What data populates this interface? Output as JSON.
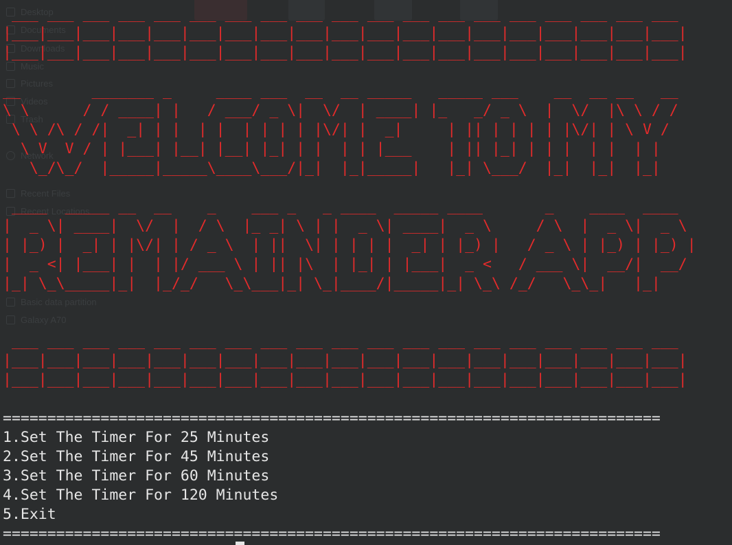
{
  "colors": {
    "background": "#2b2d2e",
    "banner": "#e32b2b",
    "menu_text": "#e6e6e6",
    "ghost_text": "#3b3e40"
  },
  "banner": {
    "top_bar": [
      " ___ ___ ___ ___ ___ ___ ___ ___ ___ ___ ___ ___ ___ ___ ___ ___ ___ ___ ___ ",
      "|___|___|___|___|___|___|___|___|___|___|___|___|___|___|___|___|___|___|___|",
      "|___|___|___|___|___|___|___|___|___|___|___|___|___|___|___|___|___|___|___|"
    ],
    "welcome": [
      "__        _______ _     ____ ___  __  __ _____   _____ ___    __  __ __   __",
      "\\ \\      / / ____| |   / ___/ _ \\|  \\/  | ____| |_   _/ _ \\  |  \\/  |\\ \\ / /",
      " \\ \\ /\\ / /|  _| | |  | |  | | | | |\\/| |  _|     | || | | | | |\\/| | \\ V / ",
      "  \\ V  V / | |___| |__| |__| |_| | |  | | |___    | || |_| | | |  | |  | |  ",
      "   \\_/\\_/  |_____|_____\\____\\___/|_|  |_|_____|   |_| \\___/  |_|  |_|  |_|  "
    ],
    "app_name": [
      " ____  _____ __  __    _    ___ _   _ ____  _____ ____       _    ____  ____  ",
      "|  _ \\| ____|  \\/  |  / \\  |_ _| \\ | |  _ \\| ____|  _ \\     / \\  |  _ \\|  _ \\ ",
      "| |_) |  _| | |\\/| | / _ \\  | ||  \\| | | | |  _| | |_) |   / _ \\ | |_) | |_) |",
      "|  _ <| |___| |  | |/ ___ \\ | || |\\  | |_| | |___|  _ <   / ___ \\|  __/|  __/ ",
      "|_| \\_\\_____|_|  |_/_/   \\_\\___|_| \\_|____/|_____|_| \\_\\ /_/   \\_\\_|   |_|    "
    ],
    "bottom_bar": [
      " ___ ___ ___ ___ ___ ___ ___ ___ ___ ___ ___ ___ ___ ___ ___ ___ ___ ___ ___ ",
      "|___|___|___|___|___|___|___|___|___|___|___|___|___|___|___|___|___|___|___|",
      "|___|___|___|___|___|___|___|___|___|___|___|___|___|___|___|___|___|___|___|"
    ]
  },
  "menu": {
    "separator": "==========================================================================",
    "options": [
      "1.Set The Timer For 25 Minutes",
      "2.Set The Timer For 45 Minutes",
      "3.Set The Timer For 60 Minutes",
      "4.Set The Timer For 120 Minutes",
      "5.Exit"
    ]
  },
  "background_window": {
    "sidebar": [
      {
        "label": "Desktop",
        "icon": "desktop-icon"
      },
      {
        "label": "Documents",
        "icon": "document-icon"
      },
      {
        "label": "Downloads",
        "icon": "download-icon"
      },
      {
        "label": "Music",
        "icon": "music-icon"
      },
      {
        "label": "Pictures",
        "icon": "picture-icon"
      },
      {
        "label": "Videos",
        "icon": "video-icon"
      },
      {
        "label": "Trash",
        "icon": "trash-icon"
      },
      {
        "label": "Network",
        "icon": "network-icon"
      },
      {
        "label": "Recent Files",
        "icon": "recent-file-icon"
      },
      {
        "label": "Recent Locations",
        "icon": "folder-icon"
      },
      {
        "label": "Basic data partition",
        "icon": "drive-icon"
      },
      {
        "label": "Galaxy A70",
        "icon": "phone-icon"
      }
    ]
  }
}
